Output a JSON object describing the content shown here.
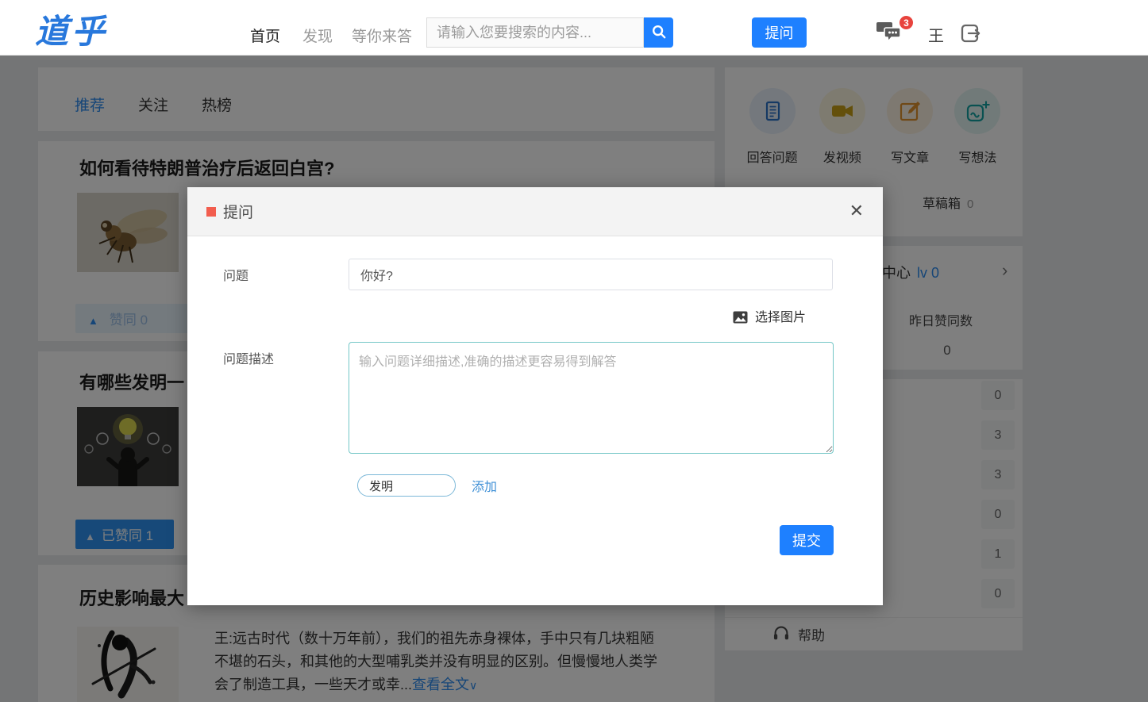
{
  "navbar": {
    "logo": "道乎",
    "nav_items": [
      {
        "label": "首页",
        "active": true
      },
      {
        "label": "发现",
        "active": false
      },
      {
        "label": "等你来答",
        "active": false
      }
    ],
    "search_placeholder": "请输入您要搜索的内容...",
    "ask_button_label": "提问",
    "message_badge_count": "3",
    "username": "王"
  },
  "feed": {
    "tabs": [
      {
        "label": "推荐",
        "active": true
      },
      {
        "label": "关注",
        "active": false
      },
      {
        "label": "热榜",
        "active": false
      }
    ],
    "articles": [
      {
        "title": "如何看待特朗普治疗后返回白宫?",
        "vote_label": "赞同 0",
        "image": "fly-photo"
      },
      {
        "title": "有哪些发明一",
        "vote_label": "已赞同 1",
        "image": "lightbulb-idea-photo"
      },
      {
        "title": "历史影响最大",
        "excerpt": "王:远古时代（数十万年前），我们的祖先赤身裸体，手中只有几块粗陋不堪的石头，和其他的大型哺乳类并没有明显的区别。但慢慢地人类学会了制造工具，一些天才或幸...",
        "read_more_label": "查看全文",
        "image": "ink-warrior-photo"
      }
    ]
  },
  "sidebar": {
    "actions": [
      {
        "label": "回答问题",
        "icon": "answer-question-icon"
      },
      {
        "label": "发视频",
        "icon": "video-camera-icon"
      },
      {
        "label": "写文章",
        "icon": "write-article-icon"
      },
      {
        "label": "写想法",
        "icon": "write-idea-icon"
      }
    ],
    "drafts_label": "草稿箱",
    "drafts_count": "0",
    "center_label": "中心",
    "center_level": "lv 0",
    "yesterday_votes_label": "昨日赞同数",
    "yesterday_votes_count": "0",
    "stat_counts": [
      "0",
      "3",
      "3",
      "0",
      "1",
      "0"
    ],
    "help_label": "帮助"
  },
  "modal": {
    "title": "提问",
    "question_label": "问题",
    "question_value": "你好?",
    "pick_image_label": "选择图片",
    "description_label": "问题描述",
    "description_placeholder": "输入问题详细描述,准确的描述更容易得到解答",
    "tag_value": "发明",
    "add_tag_label": "添加",
    "submit_label": "提交"
  },
  "icons": {
    "close_glyph": "✕",
    "chevron_right_glyph": "›",
    "chevron_down_glyph": "∨",
    "vote_up_glyph": "▲"
  },
  "colors": {
    "primary_blue": "#1e80ff",
    "link_blue": "#2d8cf0",
    "badge_red": "#e8433d",
    "modal_accent_red": "#f25d4e",
    "textarea_teal_border": "#74c7c7"
  }
}
